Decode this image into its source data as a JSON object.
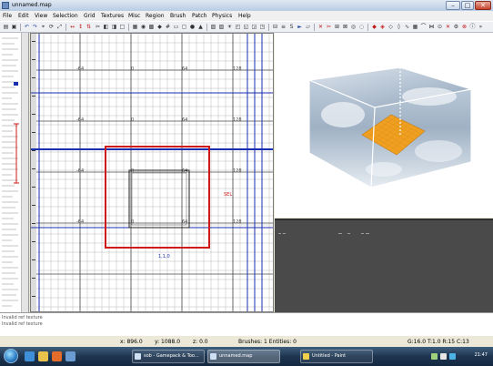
{
  "window": {
    "title": "unnamed.map",
    "controls": [
      "–",
      "□",
      "✕"
    ]
  },
  "menu": {
    "items": [
      "File",
      "Edit",
      "View",
      "Selection",
      "Grid",
      "Textures",
      "Misc",
      "Region",
      "Brush",
      "Patch",
      "Physics",
      "Help"
    ]
  },
  "toolbar": {
    "icons": [
      "open-icon",
      "save-icon",
      "undo-icon",
      "redo-icon",
      "select-icon",
      "rotate-icon",
      "scale-icon",
      "flip-x-icon",
      "flip-y-icon",
      "flip-z-icon",
      "clipper-icon",
      "csg-subtract-icon",
      "csg-merge-icon",
      "hollow-icon",
      "texture-lock-icon",
      "camera-icon",
      "patch-icon",
      "entity-icon",
      "filter-icon",
      "close-icon"
    ]
  },
  "xy_view": {
    "grid_labels": [
      "-64",
      "0",
      "64",
      "128",
      "-64",
      "0",
      "64",
      "128",
      "-64",
      "0",
      "64",
      "128",
      "-64",
      "0",
      "64",
      "128"
    ],
    "selection_label": "SEL",
    "brush_label": "1,1,0"
  },
  "console": {
    "lines": [
      "Invalid ref texture",
      "Invalid ref texture"
    ]
  },
  "status": {
    "coords_x": "x: 896.0",
    "coords_y": "y: 1088.0",
    "coords_z": "z: 0.0",
    "counts": "Brushes: 1  Entities: 0",
    "grid": "G:16.0  T:1.0  R:15  C:13"
  },
  "taskbar": {
    "tasks": [
      {
        "label": "sob - Gamepack & Too..."
      },
      {
        "label": "unnamed.map"
      },
      {
        "label": "Untitled - Paint"
      }
    ],
    "clock": "21:47"
  },
  "colors": {
    "selection": "#d01818",
    "axis": "#1a2fb0",
    "brush_fill": "#f0a020",
    "grid": "#8a8a8a"
  }
}
